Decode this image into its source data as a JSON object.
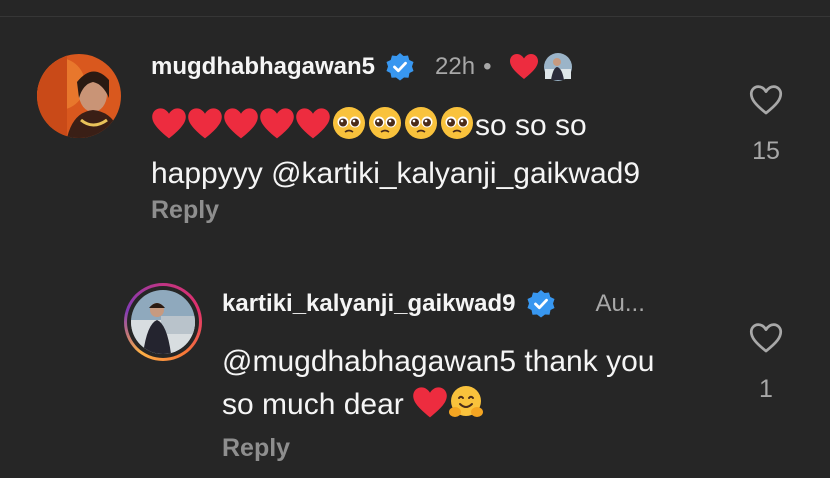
{
  "comments": [
    {
      "username": "mugdhabhagawan5",
      "time": "22h",
      "dot": "•",
      "text_line1": "so so so",
      "text_line2": "happyyy @kartiki_kalyanji_gaikwad9",
      "reply_label": "Reply",
      "like_count": "15",
      "emoji_hearts": 5,
      "emoji_faces": 4
    },
    {
      "username": "kartiki_kalyanji_gaikwad9",
      "time": "Au...",
      "text_line1": "@mugdhabhagawan5 thank you",
      "text_line2": "so much dear",
      "reply_label": "Reply",
      "like_count": "1"
    }
  ],
  "icons": {
    "verified": "verified-badge-icon",
    "heart_outline": "heart-outline-icon",
    "red_heart": "red-heart-emoji",
    "pleading": "pleading-face-emoji",
    "hug": "hugging-face-emoji"
  },
  "colors": {
    "background": "#262626",
    "verified_blue": "#3897f0",
    "heart_red": "#ed2c3f",
    "secondary_text": "#a8a8a8"
  }
}
